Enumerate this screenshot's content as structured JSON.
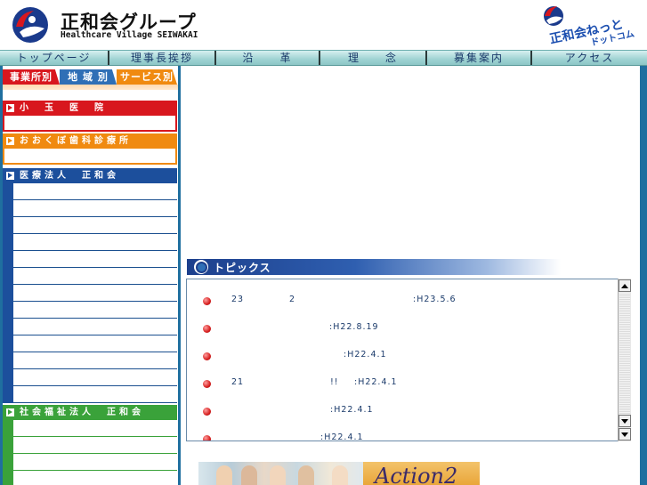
{
  "header": {
    "title": "正和会グループ",
    "subtitle": "Healthcare Village SEIWAKAI",
    "net_logo_line1": "正和会ねっと",
    "net_logo_line2": "ドットコム"
  },
  "nav": {
    "items": [
      {
        "label": "トップページ"
      },
      {
        "label": "理事長挨拶"
      },
      {
        "label": "沿　　革"
      },
      {
        "label": "理　　念"
      },
      {
        "label": "募集案内"
      },
      {
        "label": "アクセス"
      }
    ]
  },
  "sidebar": {
    "tabs": [
      {
        "label": "事業所別"
      },
      {
        "label": "地 域 別"
      },
      {
        "label": "サービス別"
      }
    ],
    "categories": [
      {
        "label": "小　玉　医　院"
      },
      {
        "label": "おおくぼ歯科診療所"
      },
      {
        "label": "医療法人　正和会"
      },
      {
        "label": "社会福祉法人　正和会"
      }
    ]
  },
  "topics": {
    "title": "トピックス",
    "items": [
      {
        "a": "23",
        "b": "2",
        "c": ":H23.5.6"
      },
      {
        "a": "",
        "b": "",
        "c": ":H22.8.19"
      },
      {
        "a": "",
        "b": "",
        "c": ":H22.4.1"
      },
      {
        "a": "21",
        "b": "!!",
        "c": ":H22.4.1"
      },
      {
        "a": "",
        "b": "",
        "c": ":H22.4.1"
      },
      {
        "a": "",
        "b": "",
        "c": ":H22.4.1"
      }
    ]
  },
  "banner": {
    "text": "Action2"
  },
  "colors": {
    "red": "#d8171e",
    "orange": "#f08a10",
    "blue": "#1c4f9c",
    "green": "#3aa23a",
    "frame": "#1f6f9f"
  }
}
